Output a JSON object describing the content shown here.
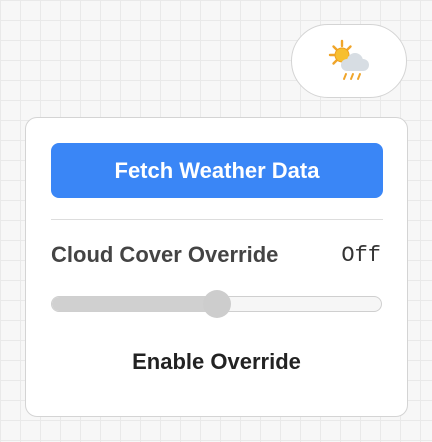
{
  "header": {
    "weather_icon": "sun-behind-cloud-with-rain-icon"
  },
  "panel": {
    "fetch_button_label": "Fetch Weather Data",
    "override_label": "Cloud Cover Override",
    "override_value": "Off",
    "slider_level": 0.5,
    "enable_override_label": "Enable Override"
  },
  "colors": {
    "accent": "#3a86f6",
    "label_text": "#444444",
    "slider_fill": "#d0d0d0",
    "slider_thumb": "#cdcdcd"
  }
}
